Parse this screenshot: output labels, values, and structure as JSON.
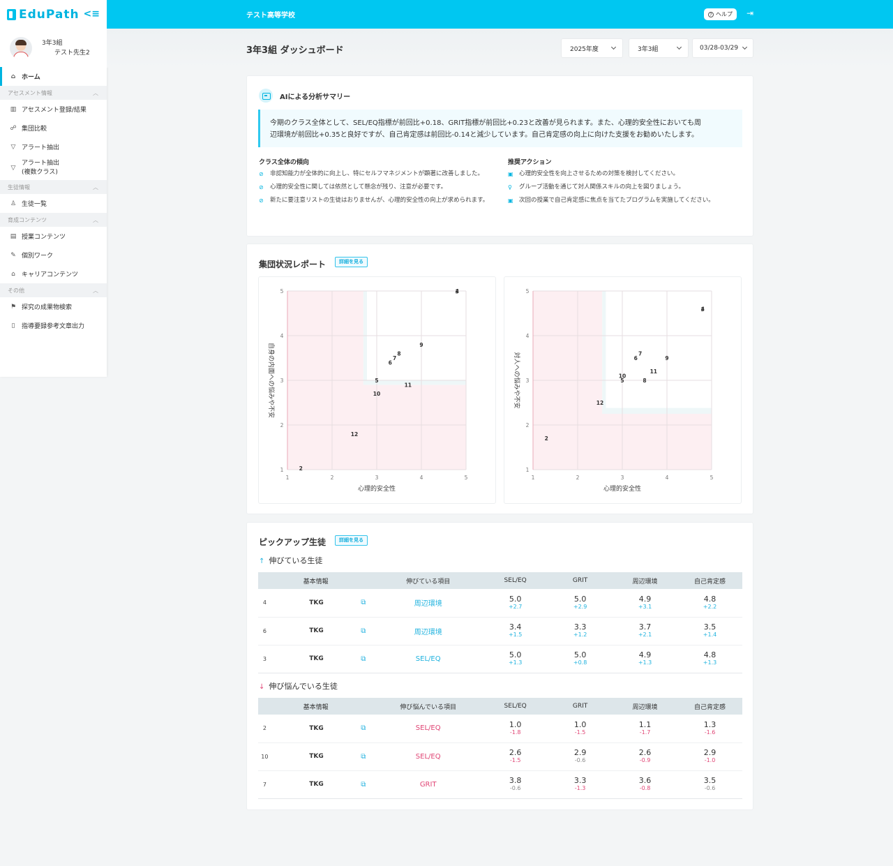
{
  "app": {
    "logo": "EduPath",
    "school": "テスト高等学校",
    "help": "ヘルプ"
  },
  "user": {
    "class": "3年3組",
    "name": "テスト先生2"
  },
  "nav": {
    "home": "ホーム",
    "assessment_section": "アセスメント情報",
    "assessment_register": "アセスメント登録/結果",
    "group_compare": "集団比較",
    "alert": "アラート抽出",
    "alert_multi_1": "アラート抽出",
    "alert_multi_2": "(複数クラス)",
    "student_section": "生徒情報",
    "student_list": "生徒一覧",
    "content_section": "育成コンテンツ",
    "lesson_content": "授業コンテンツ",
    "individual_work": "個別ワーク",
    "career_content": "キャリアコンテンツ",
    "other_section": "その他",
    "inquiry_search": "探究の成果物検索",
    "guidance_output": "指導要録参考文章出力"
  },
  "page": {
    "title": "3年3組 ダッシュボード",
    "filters": {
      "year": "2025年度",
      "class": "3年3組",
      "period": "03/28-03/29"
    }
  },
  "ai": {
    "title": "AIによる分析サマリー",
    "summary_line1": "今期のクラス全体として、SEL/EQ指標が前回比+0.18、GRIT指標が前回比+0.23と改善が見られます。また、心理的安全性においても周",
    "summary_line2": "辺環境が前回比+0.35と良好ですが、自己肯定感は前回比-0.14と減少しています。自己肯定感の向上に向けた支援をお勧めいたします。",
    "trend_title": "クラス全体の傾向",
    "trends": [
      "非認知能力が全体的に向上し、特にセルフマネジメントが顕著に改善しました。",
      "心理的安全性に関しては依然として懸念が残り、注意が必要です。",
      "新たに要注意リストの生徒はおりませんが、心理的安全性の向上が求められます。"
    ],
    "action_title": "推奨アクション",
    "actions": [
      "心理的安全性を向上させるための対策を検討してください。",
      "グループ活動を通じて対人関係スキルの向上を図りましょう。",
      "次回の授業で自己肯定感に焦点を当てたプログラムを実施してください。"
    ]
  },
  "report": {
    "title": "集団状況レポート",
    "detail": "詳細を見る"
  },
  "chart_data": [
    {
      "type": "scatter",
      "xlabel": "心理的安全性",
      "ylabel": "自身の内面への悩みや不安",
      "xlim": [
        1,
        5
      ],
      "ylim": [
        1,
        5
      ],
      "xticks": [
        "1",
        "2",
        "3",
        "4",
        "5"
      ],
      "yticks": [
        "1",
        "2",
        "3",
        "4",
        "5"
      ],
      "points": [
        {
          "label": "3",
          "x": 4.8,
          "y": 4.99
        },
        {
          "label": "4",
          "x": 4.8,
          "y": 5.0
        },
        {
          "label": "9",
          "x": 4.0,
          "y": 3.8
        },
        {
          "label": "8",
          "x": 3.5,
          "y": 3.6
        },
        {
          "label": "7",
          "x": 3.4,
          "y": 3.5
        },
        {
          "label": "6",
          "x": 3.3,
          "y": 3.4
        },
        {
          "label": "5",
          "x": 3.0,
          "y": 3.0
        },
        {
          "label": "11",
          "x": 3.7,
          "y": 2.9
        },
        {
          "label": "10",
          "x": 3.0,
          "y": 2.7
        },
        {
          "label": "12",
          "x": 2.5,
          "y": 1.8
        },
        {
          "label": "2",
          "x": 1.3,
          "y": 1.03
        }
      ]
    },
    {
      "type": "scatter",
      "xlabel": "心理的安全性",
      "ylabel": "対人への悩みや不安",
      "xlim": [
        1,
        5
      ],
      "ylim": [
        1,
        5
      ],
      "xticks": [
        "1",
        "2",
        "3",
        "4",
        "5"
      ],
      "yticks": [
        "1",
        "2",
        "3",
        "4",
        "5"
      ],
      "points": [
        {
          "label": "3",
          "x": 4.8,
          "y": 4.59
        },
        {
          "label": "4",
          "x": 4.8,
          "y": 4.6
        },
        {
          "label": "7",
          "x": 3.4,
          "y": 3.6
        },
        {
          "label": "6",
          "x": 3.3,
          "y": 3.5
        },
        {
          "label": "9",
          "x": 4.0,
          "y": 3.5
        },
        {
          "label": "11",
          "x": 3.7,
          "y": 3.2
        },
        {
          "label": "10",
          "x": 3.0,
          "y": 3.1
        },
        {
          "label": "5",
          "x": 3.0,
          "y": 3.0
        },
        {
          "label": "8",
          "x": 3.5,
          "y": 3.0
        },
        {
          "label": "12",
          "x": 2.5,
          "y": 2.5
        },
        {
          "label": "2",
          "x": 1.3,
          "y": 1.7
        }
      ]
    }
  ],
  "pickup": {
    "title": "ピックアップ生徒",
    "detail": "詳細を見る",
    "growing_title": "伸びている生徒",
    "struggling_title": "伸び悩んでいる生徒",
    "headers_growing": [
      "基本情報",
      "伸びている項目",
      "SEL/EQ",
      "GRIT",
      "周辺環境",
      "自己肯定感"
    ],
    "headers_struggling": [
      "基本情報",
      "伸び悩んでいる項目",
      "SEL/EQ",
      "GRIT",
      "周辺環境",
      "自己肯定感"
    ],
    "growing": [
      {
        "no": "4",
        "name": "TKG",
        "item": "周辺環境",
        "vals": [
          [
            "5.0",
            "+2.7"
          ],
          [
            "5.0",
            "+2.9"
          ],
          [
            "4.9",
            "+3.1"
          ],
          [
            "4.8",
            "+2.2"
          ]
        ]
      },
      {
        "no": "6",
        "name": "TKG",
        "item": "周辺環境",
        "vals": [
          [
            "3.4",
            "+1.5"
          ],
          [
            "3.3",
            "+1.2"
          ],
          [
            "3.7",
            "+2.1"
          ],
          [
            "3.5",
            "+1.4"
          ]
        ]
      },
      {
        "no": "3",
        "name": "TKG",
        "item": "SEL/EQ",
        "vals": [
          [
            "5.0",
            "+1.3"
          ],
          [
            "5.0",
            "+0.8"
          ],
          [
            "4.9",
            "+1.3"
          ],
          [
            "4.8",
            "+1.3"
          ]
        ]
      }
    ],
    "struggling": [
      {
        "no": "2",
        "name": "TKG",
        "item": "SEL/EQ",
        "vals": [
          [
            "1.0",
            "-1.8"
          ],
          [
            "1.0",
            "-1.5"
          ],
          [
            "1.1",
            "-1.7"
          ],
          [
            "1.3",
            "-1.6"
          ]
        ]
      },
      {
        "no": "10",
        "name": "TKG",
        "item": "SEL/EQ",
        "vals": [
          [
            "2.6",
            "-1.5"
          ],
          [
            "2.9",
            "-0.6"
          ],
          [
            "2.6",
            "-0.9"
          ],
          [
            "2.9",
            "-1.0"
          ]
        ]
      },
      {
        "no": "7",
        "name": "TKG",
        "item": "GRIT",
        "vals": [
          [
            "3.8",
            "-0.6"
          ],
          [
            "3.3",
            "-1.3"
          ],
          [
            "3.6",
            "-0.8"
          ],
          [
            "3.5",
            "-0.6"
          ]
        ]
      }
    ]
  }
}
